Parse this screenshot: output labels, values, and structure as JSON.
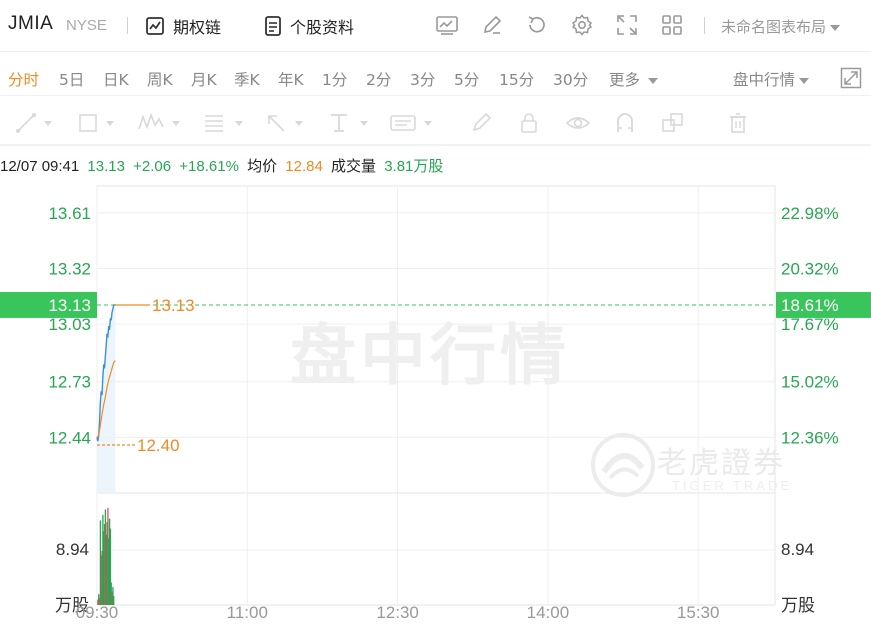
{
  "header": {
    "symbol": "JMIA",
    "exchange": "NYSE",
    "options_chain": "期权链",
    "stock_profile": "个股资料",
    "layout_name": "未命名图表布局"
  },
  "periods": {
    "items": [
      "分时",
      "5日",
      "日K",
      "周K",
      "月K",
      "季K",
      "年K",
      "1分",
      "2分",
      "3分",
      "5分",
      "15分",
      "30分"
    ],
    "active": "分时",
    "more": "更多",
    "session": "盘中行情"
  },
  "quote": {
    "datetime": "12/07 09:41",
    "price": "13.13",
    "change": "+2.06",
    "change_pct": "+18.61%",
    "avg_label": "均价",
    "avg_value": "12.84",
    "volume_label": "成交量",
    "volume_value": "3.81万股"
  },
  "watermark": {
    "text": "盘中行情",
    "brand": "老虎證券",
    "brand_sub": "TIGER TRADE"
  },
  "colors": {
    "up": "#27a653",
    "accent": "#f08a24",
    "price_line": "#3b8fd9",
    "badge": "#3ac55c"
  },
  "chart_data": {
    "type": "line",
    "y_ticks_left": [
      "13.61",
      "13.32",
      "13.03",
      "12.73",
      "12.44"
    ],
    "y_ticks_right": [
      "22.98%",
      "20.32%",
      "17.67%",
      "15.02%",
      "12.36%"
    ],
    "y_tick_values": [
      13.61,
      13.32,
      13.03,
      12.73,
      12.44
    ],
    "price_range": [
      12.15,
      13.75
    ],
    "current_price_label": "13.13",
    "current_pct_label": "18.61%",
    "current_price": 13.13,
    "high_label": "13.13",
    "low_label": "12.40",
    "low_value": 12.4,
    "volume_tick": "8.94",
    "volume_unit": "万股",
    "volume_range": [
      0,
      12
    ],
    "x_ticks": [
      "09:30",
      "11:00",
      "12:30",
      "14:00",
      "15:30"
    ],
    "x_tick_minutes": [
      0,
      90,
      180,
      270,
      360
    ],
    "x_range_minutes": [
      0,
      406
    ],
    "series": [
      {
        "name": "price",
        "minutes": [
          0,
          0.5,
          1,
          1.5,
          2,
          2.5,
          3,
          3.5,
          4,
          4.5,
          5,
          5.5,
          6,
          6.5,
          7,
          7.5,
          8,
          8.5,
          9,
          9.5,
          10,
          11
        ],
        "values": [
          12.44,
          12.42,
          12.45,
          12.52,
          12.62,
          12.68,
          12.66,
          12.75,
          12.82,
          12.8,
          12.86,
          12.92,
          12.98,
          12.97,
          13.02,
          13.0,
          13.06,
          13.05,
          13.09,
          13.11,
          13.13,
          13.13
        ]
      },
      {
        "name": "avg",
        "minutes": [
          0,
          1,
          2,
          3,
          4,
          5,
          6,
          7,
          8,
          9,
          10,
          11
        ],
        "values": [
          12.44,
          12.45,
          12.5,
          12.56,
          12.61,
          12.65,
          12.7,
          12.74,
          12.77,
          12.8,
          12.83,
          12.84
        ]
      },
      {
        "name": "volume",
        "minutes": [
          0.5,
          1,
          1.5,
          2,
          2.5,
          3,
          3.5,
          4,
          4.5,
          5,
          5.5,
          6,
          6.5,
          7,
          7.5,
          8,
          8.5,
          9,
          9.5,
          10
        ],
        "values": [
          0.6,
          1.2,
          0.8,
          9.4,
          5.5,
          6.0,
          10.0,
          8.2,
          9.0,
          10.6,
          7.8,
          9.2,
          10.8,
          7.4,
          9.6,
          8.5,
          2.5,
          1.5,
          2.0,
          1.0
        ],
        "direction": [
          "down",
          "up",
          "down",
          "up",
          "up",
          "down",
          "up",
          "up",
          "down",
          "up",
          "up",
          "up",
          "down",
          "up",
          "up",
          "up",
          "up",
          "down",
          "up",
          "up"
        ]
      }
    ]
  }
}
